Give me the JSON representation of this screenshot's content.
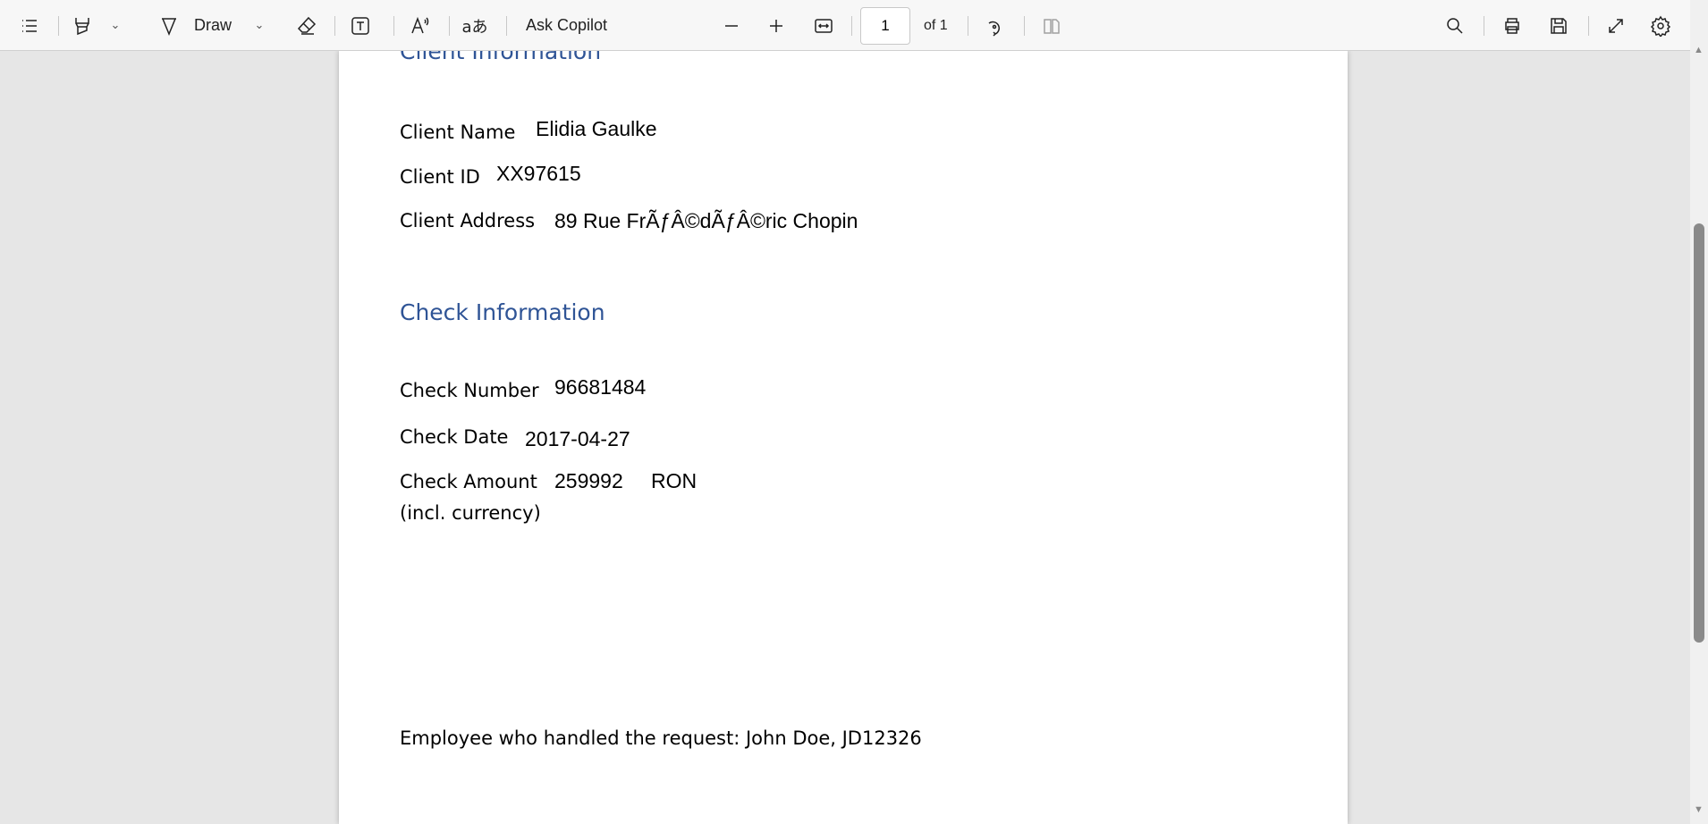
{
  "toolbar": {
    "draw_label": "Draw",
    "ask_copilot": "Ask Copilot",
    "page_current": "1",
    "page_total": "of 1",
    "icons": [
      "contents-icon",
      "highlighter-icon",
      "draw-icon",
      "eraser-icon",
      "text-box-icon",
      "read-aloud-icon",
      "translate-icon",
      "zoom-out-icon",
      "zoom-in-icon",
      "fit-width-icon",
      "rotate-icon",
      "two-page-icon",
      "search-icon",
      "print-icon",
      "save-icon",
      "fullscreen-icon",
      "settings-icon"
    ]
  },
  "document": {
    "client_heading": "Client Information",
    "client_name_label": "Client Name",
    "client_name": "Elidia Gaulke",
    "client_id_label": "Client ID",
    "client_id": "XX97615",
    "client_address_label": "Client Address",
    "client_address": "89 Rue FrÃƒÂ©dÃƒÂ©ric Chopin",
    "check_heading": "Check Information",
    "check_number_label": "Check Number",
    "check_number": "96681484",
    "check_date_label": "Check Date",
    "check_date": "2017-04-27",
    "check_amount_label": "Check Amount",
    "check_amount_sub": "(incl. currency)",
    "check_amount": "259992",
    "check_currency": "RON",
    "employee": "Employee who handled the request: John Doe, JD12326"
  },
  "colors": {
    "heading": "#2f5496"
  }
}
